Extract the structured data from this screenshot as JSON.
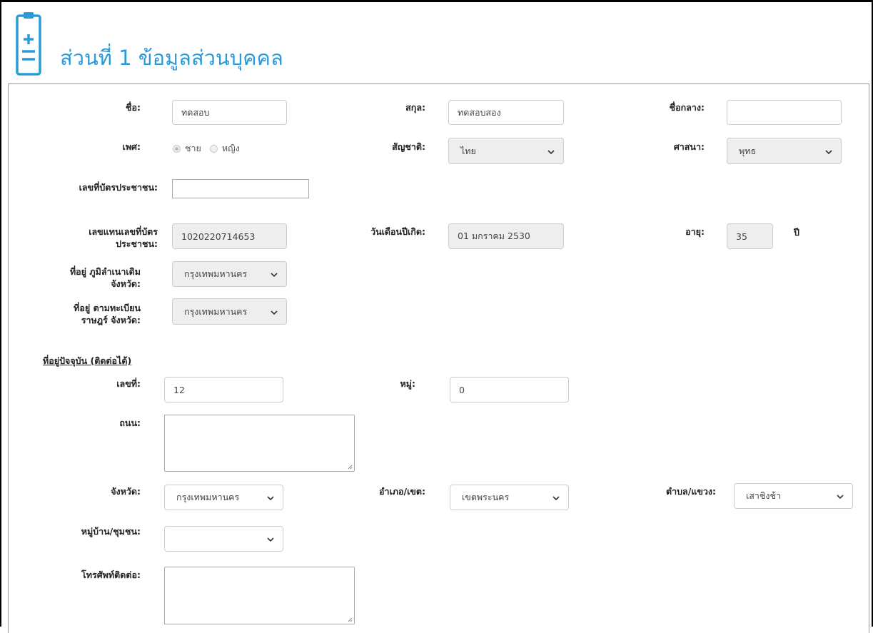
{
  "header": {
    "title": "ส่วนที่ 1 ข้อมูลส่วนบุคคล",
    "icon": "clipboard-icon",
    "accent_color": "#2a9bd9"
  },
  "personal": {
    "first_name": {
      "label": "ชื่อ:",
      "value": "ทดสอบ"
    },
    "last_name": {
      "label": "สกุล:",
      "value": "ทดสอบสอง"
    },
    "middle_name": {
      "label": "ชื่อกลาง:",
      "value": ""
    },
    "gender": {
      "label": "เพศ:",
      "options": [
        "ชาย",
        "หญิง"
      ],
      "selected": "ชาย"
    },
    "nationality": {
      "label": "สัญชาติ:",
      "value": "ไทย"
    },
    "religion": {
      "label": "ศาสนา:",
      "value": "พุทธ"
    },
    "id_card": {
      "label": "เลขที่บัตรประชาชน:",
      "value": ""
    },
    "id_substitute": {
      "label_line1": "เลขแทนเลขที่บัตร",
      "label_line2": "ประชาชน:",
      "value": "1020220714653"
    },
    "birth_date": {
      "label": "วันเดือนปีเกิด:",
      "value": "01 มกราคม 2530"
    },
    "age": {
      "label": "อายุ:",
      "value": "35",
      "unit": "ปี"
    },
    "origin_province": {
      "label_line1": "ที่อยู่ ภูมิลำเนาเดิม",
      "label_line2": "จังหวัด:",
      "value": "กรุงเทพมหานคร"
    },
    "registered_province": {
      "label_line1": "ที่อยู่ ตามทะเบียน",
      "label_line2": "ราษฎร์ จังหวัด:",
      "value": "กรุงเทพมหานคร"
    }
  },
  "address": {
    "section_title": "ที่อยู่ปัจจุบัน (ติดต่อได้)",
    "house_no": {
      "label": "เลขที่:",
      "value": "12"
    },
    "moo": {
      "label": "หมู่:",
      "value": "0"
    },
    "road": {
      "label": "ถนน:",
      "value": ""
    },
    "province": {
      "label": "จังหวัด:",
      "value": "กรุงเทพมหานคร"
    },
    "district": {
      "label": "อำเภอ/เขต:",
      "value": "เขตพระนคร"
    },
    "subdistrict": {
      "label": "ตำบล/แขวง:",
      "value": "เสาชิงช้า"
    },
    "village": {
      "label": "หมู่บ้าน/ชุมชน:",
      "value": ""
    },
    "phone": {
      "label": "โทรศัพท์ติดต่อ:",
      "value": ""
    }
  }
}
